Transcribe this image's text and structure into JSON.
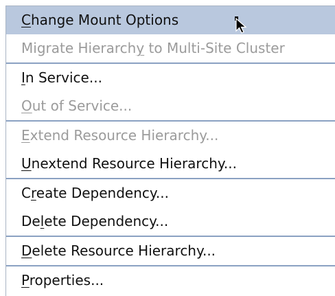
{
  "menu": {
    "items": [
      {
        "pre": "",
        "u": "C",
        "post": "hange Mount Options",
        "disabled": false,
        "selected": true
      },
      {
        "pre": "Migrate Hierarch",
        "u": "y",
        "post": " to Multi-Site Cluster",
        "disabled": true
      },
      {
        "pre": "",
        "u": "I",
        "post": "n Service...",
        "disabled": false
      },
      {
        "pre": "",
        "u": "O",
        "post": "ut of Service...",
        "disabled": true
      },
      {
        "pre": "",
        "u": "E",
        "post": "xtend Resource Hierarchy...",
        "disabled": true
      },
      {
        "pre": "",
        "u": "U",
        "post": "nextend Resource Hierarchy...",
        "disabled": false
      },
      {
        "pre": "C",
        "u": "r",
        "post": "eate Dependency...",
        "disabled": false
      },
      {
        "pre": "De",
        "u": "l",
        "post": "ete Dependency...",
        "disabled": false
      },
      {
        "pre": "",
        "u": "D",
        "post": "elete Resource Hierarchy...",
        "disabled": false
      },
      {
        "pre": "",
        "u": "P",
        "post": "roperties...",
        "disabled": false
      }
    ]
  },
  "colors": {
    "selection": "#b9c8de",
    "separator": "#8aa1c2",
    "disabled_text": "#9b9b9b",
    "border": "#a9b4c4"
  }
}
